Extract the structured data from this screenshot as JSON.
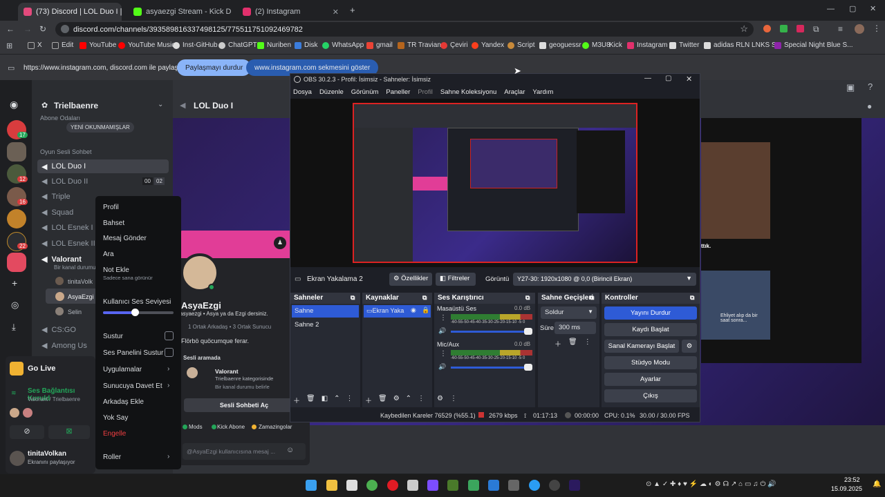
{
  "browser": {
    "tabs": [
      {
        "label": "(73) Discord | LOL Duo I | Tr",
        "color": "#e34a7c"
      },
      {
        "label": "asyaezgi Stream - Kick Dashbo",
        "color": "#53fc18"
      },
      {
        "label": "(2) Instagram",
        "color": "#e1306c"
      }
    ],
    "url": "discord.com/channels/393589816337498125/775511751092469782",
    "bookmarks": [
      "X",
      "Edit",
      "YouTube",
      "YouTube Music",
      "Inst-GitHub",
      "ChatGPT",
      "Nuriben",
      "Disk",
      "WhatsApp",
      "gmail",
      "TR Travian",
      "Çeviri",
      "Yandex",
      "Script",
      "geoguessr",
      "M3U8",
      "Kick",
      "Instagram",
      "Twitter",
      "adidas RLN LNKS S...",
      "Special Night Blue S..."
    ],
    "share_text": "https://www.instagram.com, discord.com ile paylaşılıyor",
    "stop_share": "Paylaşmayı durdur",
    "switch_tab": "www.instagram.com sekmesini göster"
  },
  "discord": {
    "server_name": "Trielbaenre",
    "subscriber": "Abone Odaları",
    "unread": "YENİ OKUNMAMIŞLAR",
    "category": "Oyun Sesli Sohbet",
    "channels": [
      "LOL Duo I",
      "LOL Duo II",
      "Triple",
      "Squad",
      "LOL Esnek I",
      "LOL Esnek II",
      "Valorant",
      "CS:GO",
      "Among Us"
    ],
    "duo2_counts": [
      "00",
      "02"
    ],
    "valorant_desc": "Bir kanal durumu",
    "members": [
      "tinitaVolk",
      "AsyaEzgi",
      "Selin"
    ],
    "main_title": "LOL Duo I",
    "badges": [
      "17",
      "12",
      "16",
      "22"
    ],
    "golive": "Go Live",
    "conn": "Ses Bağlantısı Kuruld",
    "conn_sub": "Valorant / Trielbaenre",
    "user": "tinitaVolkan",
    "user_status": "Ekranını paylaşıyor",
    "profile": {
      "name": "AsyaEzgi",
      "handle": "asyaezgi • Asya ya da Ezgi dersiniz.",
      "mutual": "1 Ortak Arkadaş • 3 Ortak Sunucu",
      "bio": "Flörbö quöcumque ferar.",
      "voice_label": "Sesli aramada",
      "voice_ch": "Valorant",
      "voice_cat": "Trielbaenre kategorisinde",
      "voice_status": "Bir kanal durumu belirle",
      "join": "Sesli Sohbeti Aç",
      "roles": [
        "Mods",
        "Kick Abone",
        "Zamazingolar"
      ],
      "msg_placeholder": "@AsyaEzgi kullanıcısına mesaj ..."
    },
    "context": {
      "items": [
        "Profil",
        "Bahset",
        "Mesaj Gönder",
        "Ara",
        "Not Ekle"
      ],
      "note_sub": "Sadece sana görünür",
      "volume": "Kullanıcı Ses Seviyesi",
      "volume_level": 0.45,
      "mute": "Sustur",
      "soundboard": "Ses Panelini Sustur",
      "apps": "Uygulamalar",
      "invite": "Sunucuya Davet Et",
      "add": "Arkadaş Ekle",
      "ignore": "Yok Say",
      "block": "Engelle",
      "roles": "Roller"
    },
    "stream_text": "ttık.",
    "mini_caption": "Ehliyet alıp da bir saat sonra..."
  },
  "obs": {
    "title": "OBS 30.2.3 - Profil: İsimsiz - Sahneler: İsimsiz",
    "menu": [
      "Dosya",
      "Düzenle",
      "Görünüm",
      "Paneller",
      "Profil",
      "Sahne Koleksiyonu",
      "Araçlar",
      "Yardım"
    ],
    "source_name": "Ekran Yakalama 2",
    "props": "Özellikler",
    "filters": "Filtreler",
    "display_label": "Görüntü",
    "display_value": "Y27-30: 1920x1080 @ 0,0 (Birincil Ekran)",
    "scenes_h": "Sahneler",
    "scenes": [
      "Sahne",
      "Sahne 2"
    ],
    "sources_h": "Kaynaklar",
    "source_item": "Ekran Yaka",
    "mixer_h": "Ses Karıştırıcı",
    "mix": [
      {
        "name": "Masaüstü Ses",
        "db": "0.0 dB"
      },
      {
        "name": "Mic/Aux",
        "db": "0.0 dB"
      }
    ],
    "meter_ticks": "-60-55-50-45-40-35-30-25-20-15-10 -5 0",
    "trans_h": "Sahne Geçişleri",
    "trans": "Soldur",
    "dur_label": "Süre",
    "dur": "300 ms",
    "ctrl_h": "Kontroller",
    "controls": [
      "Yayını Durdur",
      "Kaydı Başlat",
      "Sanal Kamerayı Başlat",
      "Stüdyo Modu",
      "Ayarlar",
      "Çıkış"
    ],
    "status": {
      "dropped": "Kaybedilen Kareler 76529 (%55.1)",
      "kbps": "2679 kbps",
      "live": "01:17:13",
      "rec": "00:00:00",
      "cpu": "CPU: 0.1%",
      "fps": "30.00 / 30.00 FPS"
    }
  },
  "taskbar": {
    "time": "23:52",
    "date": "15.09.2025"
  }
}
